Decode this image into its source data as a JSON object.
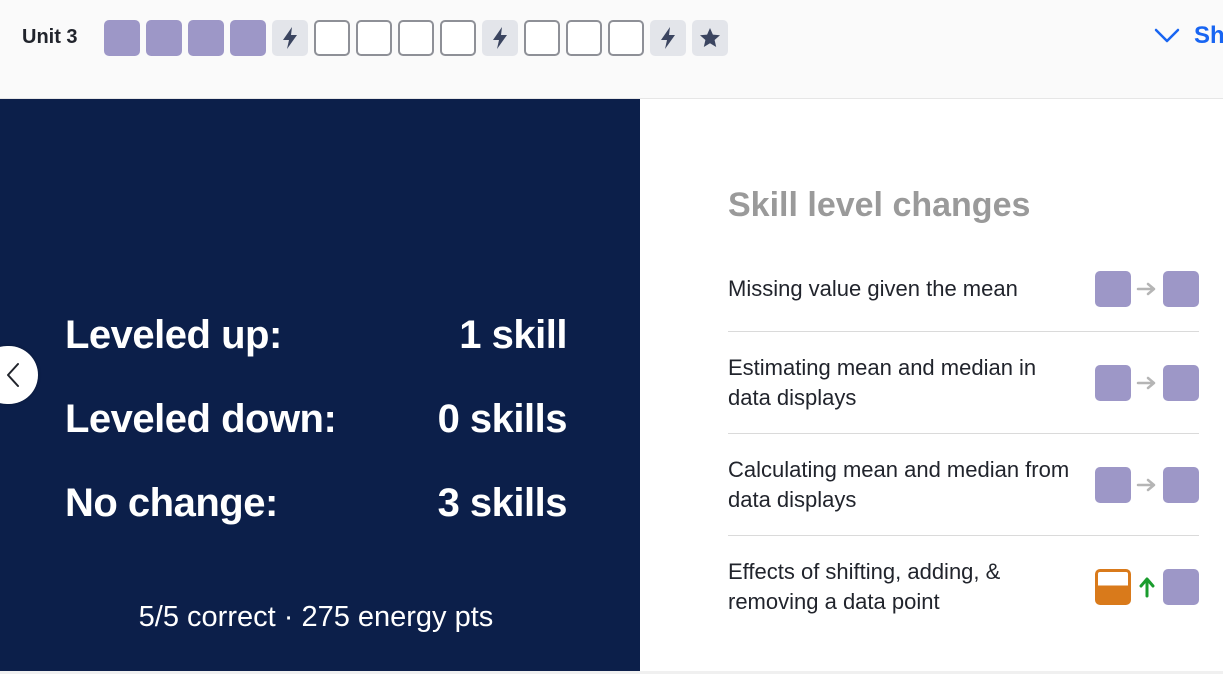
{
  "header": {
    "unit_label": "Unit 3",
    "show_more_label": "Sh",
    "progress": [
      {
        "type": "filled"
      },
      {
        "type": "filled"
      },
      {
        "type": "filled"
      },
      {
        "type": "filled"
      },
      {
        "type": "quiz",
        "icon": "lightning-icon"
      },
      {
        "type": "empty"
      },
      {
        "type": "empty"
      },
      {
        "type": "empty"
      },
      {
        "type": "empty"
      },
      {
        "type": "quiz",
        "icon": "lightning-icon"
      },
      {
        "type": "empty"
      },
      {
        "type": "empty"
      },
      {
        "type": "empty"
      },
      {
        "type": "quiz",
        "icon": "lightning-icon"
      },
      {
        "type": "unit-test",
        "icon": "star-icon"
      }
    ]
  },
  "summary_panel": {
    "stats": [
      {
        "label": "Leveled up:",
        "value": "1 skill"
      },
      {
        "label": "Leveled down:",
        "value": "0 skills"
      },
      {
        "label": "No change:",
        "value": "3 skills"
      }
    ],
    "result": "5/5 correct · 275 energy pts"
  },
  "skill_changes": {
    "heading": "Skill level changes",
    "skills": [
      {
        "name": "Missing value given the mean",
        "from": "proficient",
        "to": "proficient",
        "change": "none"
      },
      {
        "name": "Estimating mean and median in data displays",
        "from": "proficient",
        "to": "proficient",
        "change": "none"
      },
      {
        "name": "Calculating mean and median from data displays",
        "from": "proficient",
        "to": "proficient",
        "change": "none"
      },
      {
        "name": "Effects of shifting, adding, & removing a data point",
        "from": "attempted",
        "to": "proficient",
        "change": "up"
      }
    ]
  },
  "colors": {
    "proficient": "#9d97c7",
    "attempted": "#d97a1b",
    "panel": "#0c1f4a",
    "link": "#1865f2",
    "level_up_arrow": "#1a9c2d",
    "no_change_arrow": "#b5b5b5"
  }
}
